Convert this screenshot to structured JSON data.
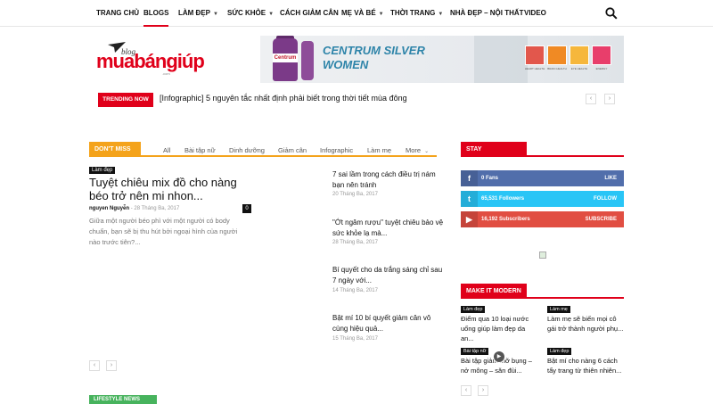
{
  "nav": {
    "items": [
      "TRANG CHỦ",
      "BLOGS",
      "LÀM ĐẸP",
      "SỨC KHỎE",
      "CÁCH GIẢM CÂN",
      "MẸ VÀ BÉ",
      "THỜI TRANG",
      "NHÀ ĐẸP – NỘI THẤT",
      "VIDEO"
    ],
    "active_index": 1,
    "search_icon": "search-icon"
  },
  "logo": {
    "prefix": "blog.",
    "main": "muabángiúp",
    "suffix": ".com"
  },
  "banner": {
    "title_line1": "CENTRUM SILVER",
    "title_line2": "WOMEN",
    "bottle_label": "Centrum",
    "icon_colors": [
      "#e2574c",
      "#f08a24",
      "#f6b73c",
      "#e83e6b"
    ],
    "icon_captions": [
      "HEART HEALTH",
      "BRAIN HEALTH",
      "EYE HEALTH",
      "ENERGY"
    ]
  },
  "trending": {
    "badge": "TRENDING NOW",
    "headline": "[Infographic] 5 nguyên tắc nhất định phải biết trong thời tiết mùa đông",
    "prev": "‹",
    "next": "›"
  },
  "dont_miss": {
    "label": "DON'T MISS",
    "accent": "#f4a31b",
    "tabs": [
      "All",
      "Bài tập nữ",
      "Dinh dưỡng",
      "Giảm cân",
      "Infographic",
      "Làm mẹ",
      "More"
    ],
    "featured": {
      "category": "Làm đẹp",
      "title": "Tuyệt chiêu mix đồ cho nàng béo trở nên mi nhon...",
      "author": "nguyen Nguyễn",
      "date": "28 Tháng Ba, 2017",
      "comments": "0",
      "excerpt": "Giữa một người béo phì với một người có body chuẩn, bạn sẽ bị thu hút bởi ngoại hình của người nào trước tiên?..."
    },
    "side_posts": [
      {
        "title": "7 sai lầm trong cách điều trị nám bạn nên tránh",
        "date": "20 Tháng Ba, 2017"
      },
      {
        "title": "\"Ớt ngâm rượu\" tuyệt chiêu bảo vệ sức khỏe lạ mà...",
        "date": "28 Tháng Ba, 2017"
      },
      {
        "title": "Bí quyết cho da trắng sáng chỉ sau 7 ngày với...",
        "date": "14 Tháng Ba, 2017"
      },
      {
        "title": "Bật mí 10 bí quyết giảm cân vô cùng hiệu quả...",
        "date": "15 Tháng Ba, 2017"
      }
    ],
    "prev": "‹",
    "next": "›"
  },
  "stay_connected": {
    "label": "STAY CONNECTED",
    "accent": "#e0001a",
    "rows": [
      {
        "icon": "facebook-icon",
        "glyph": "f",
        "count": "0",
        "unit": "Fans",
        "action": "LIKE",
        "color": "#516eab"
      },
      {
        "icon": "twitter-icon",
        "glyph": "t",
        "count": "65,531",
        "unit": "Followers",
        "action": "FOLLOW",
        "color": "#29c5f6"
      },
      {
        "icon": "youtube-icon",
        "glyph": "▶",
        "count": "16,192",
        "unit": "Subscribers",
        "action": "SUBSCRIBE",
        "color": "#e14e42"
      }
    ]
  },
  "make_it_modern": {
    "label": "MAKE IT MODERN",
    "accent": "#e0001a",
    "posts": [
      {
        "category": "Làm đẹp",
        "title": "Điểm qua 10 loại nước uống giúp làm đẹp da an..."
      },
      {
        "category": "Làm mẹ",
        "title": "Làm mẹ sẽ biến mọi cô gái trở thành người phụ..."
      },
      {
        "category": "Bài tập nữ",
        "title": "Bài tập giảm mỡ bụng – nở mông – săn đùi..."
      },
      {
        "category": "Làm đẹp",
        "title": "Bật mí cho nàng 6 cách tẩy trang từ thiên nhiên..."
      }
    ],
    "prev": "‹",
    "next": "›"
  },
  "lifestyle": {
    "label": "LIFESTYLE NEWS"
  }
}
